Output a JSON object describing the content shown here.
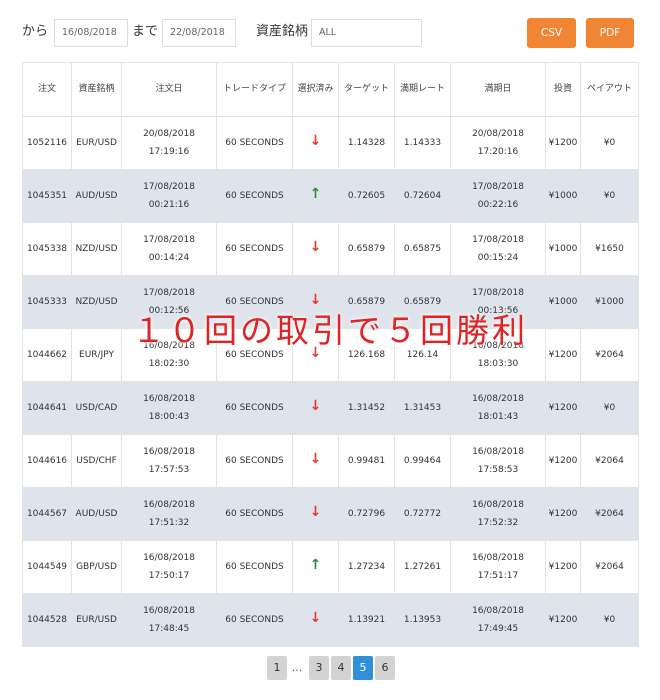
{
  "filters": {
    "from_label": "から",
    "from_value": "16/08/2018",
    "to_label": "まで",
    "to_value": "22/08/2018",
    "asset_label": "資産銘柄",
    "asset_value": "ALL",
    "csv_label": "CSV",
    "pdf_label": "PDF",
    "accent_color": "#f08634"
  },
  "table": {
    "headers": [
      "注文",
      "資産銘柄",
      "注文日",
      "トレードタイプ",
      "選択済み",
      "ターゲット",
      "満期レート",
      "満期日",
      "投資",
      "ペイアウト"
    ],
    "rows": [
      {
        "id": "1052116",
        "asset": "EUR/USD",
        "date": "20/08/2018",
        "time": "17:19:16",
        "type": "60 SECONDS",
        "dir": "down",
        "target": "1.14328",
        "expiry_rate": "1.14333",
        "expiry_date": "20/08/2018",
        "expiry_time": "17:20:16",
        "invest": "¥1200",
        "payout": "¥0"
      },
      {
        "id": "1045351",
        "asset": "AUD/USD",
        "date": "17/08/2018",
        "time": "00:21:16",
        "type": "60 SECONDS",
        "dir": "up",
        "target": "0.72605",
        "expiry_rate": "0.72604",
        "expiry_date": "17/08/2018",
        "expiry_time": "00:22:16",
        "invest": "¥1000",
        "payout": "¥0"
      },
      {
        "id": "1045338",
        "asset": "NZD/USD",
        "date": "17/08/2018",
        "time": "00:14:24",
        "type": "60 SECONDS",
        "dir": "down",
        "target": "0.65879",
        "expiry_rate": "0.65875",
        "expiry_date": "17/08/2018",
        "expiry_time": "00:15:24",
        "invest": "¥1000",
        "payout": "¥1650"
      },
      {
        "id": "1045333",
        "asset": "NZD/USD",
        "date": "17/08/2018",
        "time": "00:12:56",
        "type": "60 SECONDS",
        "dir": "down",
        "target": "0.65879",
        "expiry_rate": "0.65879",
        "expiry_date": "17/08/2018",
        "expiry_time": "00:13:56",
        "invest": "¥1000",
        "payout": "¥1000"
      },
      {
        "id": "1044662",
        "asset": "EUR/JPY",
        "date": "16/08/2018",
        "time": "18:02:30",
        "type": "60 SECONDS",
        "dir": "down",
        "target": "126.168",
        "expiry_rate": "126.14",
        "expiry_date": "16/08/2018",
        "expiry_time": "18:03:30",
        "invest": "¥1200",
        "payout": "¥2064"
      },
      {
        "id": "1044641",
        "asset": "USD/CAD",
        "date": "16/08/2018",
        "time": "18:00:43",
        "type": "60 SECONDS",
        "dir": "down",
        "target": "1.31452",
        "expiry_rate": "1.31453",
        "expiry_date": "16/08/2018",
        "expiry_time": "18:01:43",
        "invest": "¥1200",
        "payout": "¥0"
      },
      {
        "id": "1044616",
        "asset": "USD/CHF",
        "date": "16/08/2018",
        "time": "17:57:53",
        "type": "60 SECONDS",
        "dir": "down",
        "target": "0.99481",
        "expiry_rate": "0.99464",
        "expiry_date": "16/08/2018",
        "expiry_time": "17:58:53",
        "invest": "¥1200",
        "payout": "¥2064"
      },
      {
        "id": "1044567",
        "asset": "AUD/USD",
        "date": "16/08/2018",
        "time": "17:51:32",
        "type": "60 SECONDS",
        "dir": "down",
        "target": "0.72796",
        "expiry_rate": "0.72772",
        "expiry_date": "16/08/2018",
        "expiry_time": "17:52:32",
        "invest": "¥1200",
        "payout": "¥2064"
      },
      {
        "id": "1044549",
        "asset": "GBP/USD",
        "date": "16/08/2018",
        "time": "17:50:17",
        "type": "60 SECONDS",
        "dir": "up",
        "target": "1.27234",
        "expiry_rate": "1.27261",
        "expiry_date": "16/08/2018",
        "expiry_time": "17:51:17",
        "invest": "¥1200",
        "payout": "¥2064"
      },
      {
        "id": "1044528",
        "asset": "EUR/USD",
        "date": "16/08/2018",
        "time": "17:48:45",
        "type": "60 SECONDS",
        "dir": "down",
        "target": "1.13921",
        "expiry_rate": "1.13953",
        "expiry_date": "16/08/2018",
        "expiry_time": "17:49:45",
        "invest": "¥1200",
        "payout": "¥0"
      }
    ],
    "alt_row_color": "#dfe3eb",
    "down_color": "#e23a2e",
    "up_color": "#2f8a3a",
    "down_icon": "arrow-down-icon",
    "up_icon": "arrow-up-icon"
  },
  "overlay": {
    "text": "１０回の取引で５回勝利",
    "color": "#e02323"
  },
  "pagination": {
    "first": "1",
    "ellipsis": "...",
    "pages": [
      "3",
      "4",
      "5",
      "6"
    ],
    "active": "5",
    "active_color": "#2f8fd8"
  }
}
